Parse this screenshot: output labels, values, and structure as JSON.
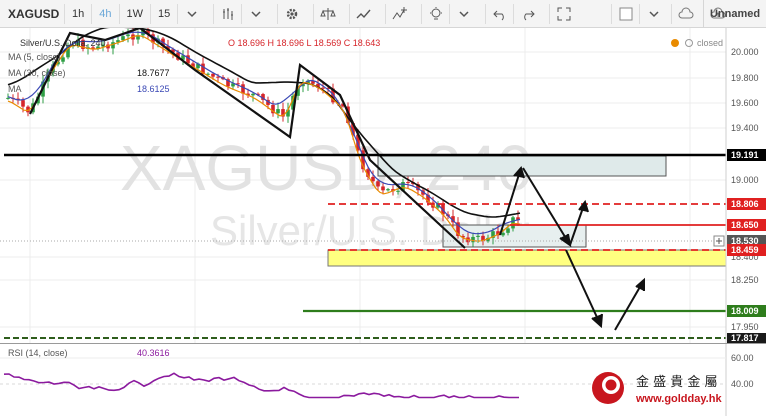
{
  "toolbar": {
    "symbol": "XAGUSD",
    "intervals": [
      "1h",
      "4h",
      "1W",
      "15"
    ],
    "active_interval": "4h",
    "icons": [
      "chevron-down-icon",
      "bar-style-icon",
      "gear-icon",
      "scale-icon",
      "indicators-icon",
      "compare-icon",
      "alert-icon",
      "undo-icon",
      "redo-icon",
      "fullscreen-icon",
      "square-icon",
      "cloud-save-icon",
      "cloud-load-icon"
    ],
    "account": "Unnamed"
  },
  "legend": {
    "title": "Silver/U.S. Dolla, 240",
    "ohlc": "O 18.696 H 18.696 L 18.569 C 18.643",
    "ma1_label": "MA (5, close)",
    "ma2_label": "MA (30, close)",
    "ma2_value": "18.7677",
    "ma3_label": "MA",
    "ma3_value": "18.6125",
    "closed": "closed"
  },
  "watermark": {
    "symbol": "XAGUSD, 240",
    "name": "Silver/U.S. Dollar"
  },
  "price_axis": {
    "ticks": [
      "20.000",
      "19.800",
      "19.600",
      "19.400",
      "19.000",
      "18.400",
      "18.250",
      "17.950"
    ],
    "tags": [
      {
        "value": "19.191",
        "color": "#000000"
      },
      {
        "value": "18.806",
        "color": "#e02020"
      },
      {
        "value": "18.650",
        "color": "#e02020"
      },
      {
        "value": "18.530",
        "color": "#555555"
      },
      {
        "value": "18.459",
        "color": "#e02020"
      },
      {
        "value": "18.009",
        "color": "#2e7d1c"
      },
      {
        "value": "17.817",
        "color": "#1a1a1a"
      }
    ]
  },
  "rsi": {
    "label": "RSI (14, close)",
    "value": "40.3616",
    "ticks": [
      "60.00",
      "40.00"
    ]
  },
  "brand": {
    "chinese": "金 盛 貴 金 屬",
    "url": "www.goldday.hk"
  },
  "colors": {
    "candle_up": "#2e9e44",
    "candle_down": "#d6252a",
    "ma5": "#e98b00",
    "ma30": "#111111",
    "ma_mid": "#3b49b5",
    "rsi": "#8b1a9e",
    "zone": "#ffff80",
    "box": "#dfeaea"
  }
}
